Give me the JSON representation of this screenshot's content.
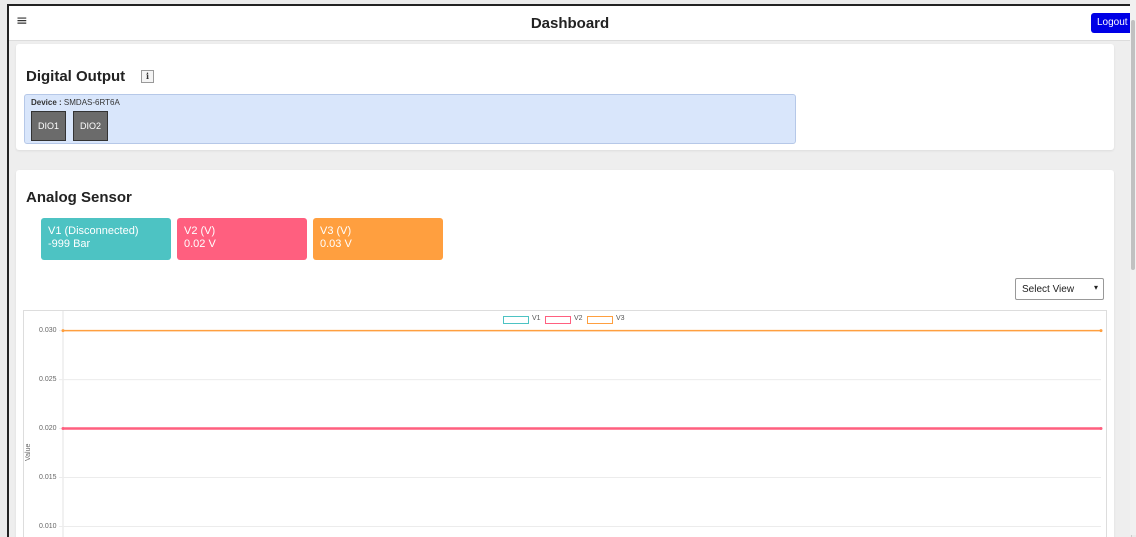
{
  "header": {
    "menu_icon": "hamburger-icon",
    "title": "Dashboard",
    "logout_label": "Logout"
  },
  "digital_output": {
    "title": "Digital Output",
    "info_icon": "info-icon",
    "info_glyph": "i",
    "device_label": "Device :",
    "device_name": "SMDAS-6RT6A",
    "buttons": [
      "DIO1",
      "DIO2"
    ]
  },
  "analog_sensor": {
    "title": "Analog Sensor",
    "tiles": [
      {
        "label": "V1 (Disconnected)",
        "value": "-999 Bar",
        "color": "#4dc3c3"
      },
      {
        "label": "V2 (V)",
        "value": "0.02 V",
        "color": "#ff5f7f"
      },
      {
        "label": "V3 (V)",
        "value": "0.03 V",
        "color": "#ff9f3f"
      }
    ],
    "select_view": {
      "selected": "Select View"
    }
  },
  "chart_data": {
    "type": "line",
    "title": "",
    "xlabel": "",
    "ylabel": "Value",
    "ylim": [
      0.0075,
      0.032
    ],
    "yticks": [
      "0.030",
      "0.025",
      "0.020",
      "0.015",
      "0.010"
    ],
    "legend_position": "top-center",
    "grid": true,
    "series": [
      {
        "name": "V1",
        "color": "#4dc3c3",
        "values": []
      },
      {
        "name": "V2",
        "color": "#ff5f7f",
        "values": [
          0.02,
          0.02
        ]
      },
      {
        "name": "V3",
        "color": "#ff9f3f",
        "values": [
          0.03,
          0.03
        ]
      }
    ]
  }
}
